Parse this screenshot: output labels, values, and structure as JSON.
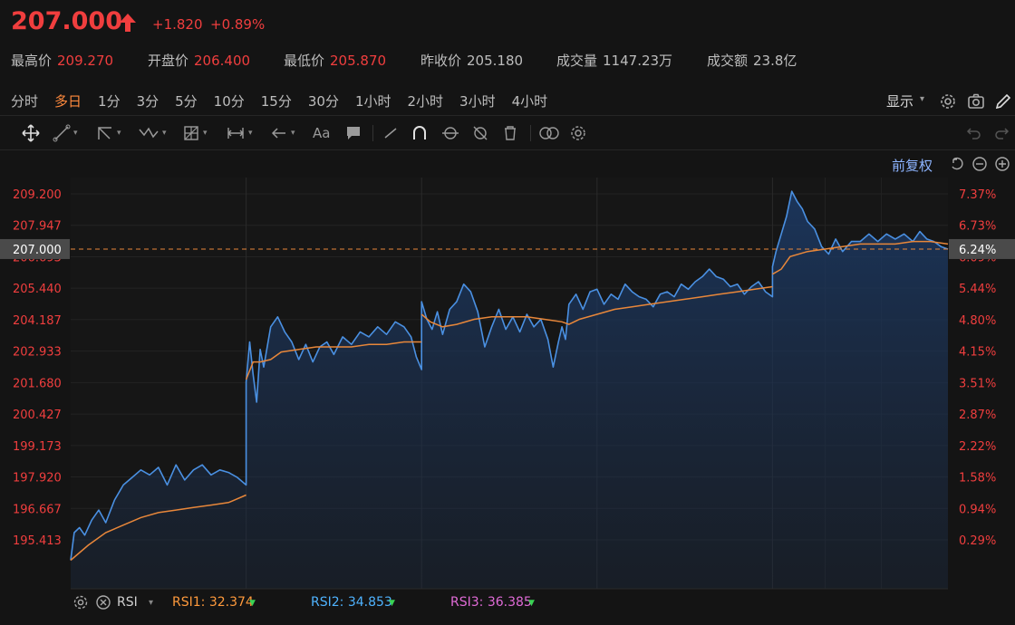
{
  "header": {
    "price": "207.000",
    "change": "+1.820",
    "change_pct": "+0.89%",
    "stats": [
      {
        "label": "最高价",
        "value": "209.270",
        "color": "#f03e3e"
      },
      {
        "label": "开盘价",
        "value": "206.400",
        "color": "#f03e3e"
      },
      {
        "label": "最低价",
        "value": "205.870",
        "color": "#f03e3e"
      },
      {
        "label": "昨收价",
        "value": "205.180",
        "color": "#bdbdbd"
      },
      {
        "label": "成交量",
        "value": "1147.23万",
        "color": "#bdbdbd"
      },
      {
        "label": "成交额",
        "value": "23.8亿",
        "color": "#bdbdbd"
      }
    ]
  },
  "tabs": [
    "分时",
    "多日",
    "1分",
    "3分",
    "5分",
    "10分",
    "15分",
    "30分",
    "1小时",
    "2小时",
    "3小时",
    "4小时"
  ],
  "active_tab": "多日",
  "toolbar": {
    "display_label": "显示",
    "font_tool_label": "Aa"
  },
  "chart_controls": {
    "adjust_label": "前复权"
  },
  "chart_data": {
    "type": "line",
    "y_ticks": [
      "209.200",
      "207.947",
      "206.693",
      "205.440",
      "204.187",
      "202.933",
      "201.680",
      "200.427",
      "199.173",
      "197.920",
      "196.667",
      "195.413"
    ],
    "y_tick_values": [
      209.2,
      207.947,
      206.693,
      205.44,
      204.187,
      202.933,
      201.68,
      200.427,
      199.173,
      197.92,
      196.667,
      195.413
    ],
    "pct_ticks": [
      "7.37%",
      "6.73%",
      "6.09%",
      "5.44%",
      "4.80%",
      "4.15%",
      "3.51%",
      "2.87%",
      "2.22%",
      "1.58%",
      "0.94%",
      "0.29%"
    ],
    "current_price_label": "207.000",
    "current_price_value": 207.0,
    "current_pct_label": "6.24%",
    "ylim": [
      194.2,
      210.4
    ],
    "days": 5,
    "price_series": {
      "name": "",
      "color": "#4a90e2",
      "points": [
        [
          0,
          194.6
        ],
        [
          0.02,
          195.7
        ],
        [
          0.05,
          195.9
        ],
        [
          0.08,
          195.6
        ],
        [
          0.12,
          196.2
        ],
        [
          0.16,
          196.6
        ],
        [
          0.2,
          196.1
        ],
        [
          0.25,
          197.0
        ],
        [
          0.3,
          197.6
        ],
        [
          0.35,
          197.9
        ],
        [
          0.4,
          198.2
        ],
        [
          0.45,
          198.0
        ],
        [
          0.5,
          198.3
        ],
        [
          0.55,
          197.6
        ],
        [
          0.6,
          198.4
        ],
        [
          0.65,
          197.8
        ],
        [
          0.7,
          198.2
        ],
        [
          0.75,
          198.4
        ],
        [
          0.8,
          198.0
        ],
        [
          0.85,
          198.2
        ],
        [
          0.9,
          198.1
        ],
        [
          0.95,
          197.9
        ],
        [
          1.0,
          197.6
        ],
        [
          1.0,
          201.7
        ],
        [
          1.02,
          203.3
        ],
        [
          1.04,
          202.0
        ],
        [
          1.06,
          200.9
        ],
        [
          1.08,
          203.0
        ],
        [
          1.1,
          202.3
        ],
        [
          1.14,
          203.9
        ],
        [
          1.18,
          204.3
        ],
        [
          1.22,
          203.7
        ],
        [
          1.26,
          203.3
        ],
        [
          1.3,
          202.6
        ],
        [
          1.34,
          203.2
        ],
        [
          1.38,
          202.5
        ],
        [
          1.42,
          203.1
        ],
        [
          1.46,
          203.3
        ],
        [
          1.5,
          202.8
        ],
        [
          1.55,
          203.5
        ],
        [
          1.6,
          203.2
        ],
        [
          1.65,
          203.7
        ],
        [
          1.7,
          203.5
        ],
        [
          1.75,
          203.9
        ],
        [
          1.8,
          203.6
        ],
        [
          1.85,
          204.1
        ],
        [
          1.9,
          203.9
        ],
        [
          1.94,
          203.5
        ],
        [
          1.97,
          202.7
        ],
        [
          2.0,
          202.2
        ],
        [
          2.0,
          204.9
        ],
        [
          2.03,
          204.2
        ],
        [
          2.06,
          203.8
        ],
        [
          2.09,
          204.5
        ],
        [
          2.12,
          203.6
        ],
        [
          2.16,
          204.6
        ],
        [
          2.2,
          204.9
        ],
        [
          2.24,
          205.6
        ],
        [
          2.28,
          205.3
        ],
        [
          2.32,
          204.5
        ],
        [
          2.36,
          203.1
        ],
        [
          2.4,
          203.9
        ],
        [
          2.44,
          204.6
        ],
        [
          2.48,
          203.8
        ],
        [
          2.52,
          204.3
        ],
        [
          2.56,
          203.7
        ],
        [
          2.6,
          204.4
        ],
        [
          2.64,
          203.9
        ],
        [
          2.68,
          204.2
        ],
        [
          2.72,
          203.4
        ],
        [
          2.75,
          202.3
        ],
        [
          2.78,
          203.3
        ],
        [
          2.8,
          203.9
        ],
        [
          2.82,
          203.4
        ],
        [
          2.84,
          204.8
        ],
        [
          2.88,
          205.2
        ],
        [
          2.92,
          204.6
        ],
        [
          2.96,
          205.3
        ],
        [
          3.0,
          205.4
        ],
        [
          3.04,
          204.8
        ],
        [
          3.08,
          205.2
        ],
        [
          3.12,
          205.0
        ],
        [
          3.16,
          205.6
        ],
        [
          3.2,
          205.3
        ],
        [
          3.24,
          205.1
        ],
        [
          3.28,
          205.0
        ],
        [
          3.32,
          204.7
        ],
        [
          3.36,
          205.2
        ],
        [
          3.4,
          205.3
        ],
        [
          3.44,
          205.1
        ],
        [
          3.48,
          205.6
        ],
        [
          3.52,
          205.4
        ],
        [
          3.56,
          205.7
        ],
        [
          3.6,
          205.9
        ],
        [
          3.64,
          206.2
        ],
        [
          3.68,
          205.9
        ],
        [
          3.72,
          205.8
        ],
        [
          3.76,
          205.5
        ],
        [
          3.8,
          205.6
        ],
        [
          3.84,
          205.2
        ],
        [
          3.88,
          205.5
        ],
        [
          3.92,
          205.7
        ],
        [
          3.96,
          205.3
        ],
        [
          4.0,
          205.1
        ],
        [
          4.0,
          206.3
        ],
        [
          4.02,
          206.9
        ],
        [
          4.05,
          207.6
        ],
        [
          4.08,
          208.3
        ],
        [
          4.11,
          209.3
        ],
        [
          4.14,
          208.9
        ],
        [
          4.17,
          208.6
        ],
        [
          4.2,
          208.1
        ],
        [
          4.24,
          207.8
        ],
        [
          4.28,
          207.1
        ],
        [
          4.32,
          206.8
        ],
        [
          4.36,
          207.4
        ],
        [
          4.4,
          206.9
        ],
        [
          4.45,
          207.3
        ],
        [
          4.5,
          207.3
        ],
        [
          4.55,
          207.6
        ],
        [
          4.6,
          207.3
        ],
        [
          4.65,
          207.6
        ],
        [
          4.7,
          207.4
        ],
        [
          4.75,
          207.6
        ],
        [
          4.8,
          207.3
        ],
        [
          4.84,
          207.7
        ],
        [
          4.88,
          207.4
        ],
        [
          4.92,
          207.3
        ],
        [
          4.96,
          207.1
        ],
        [
          5.0,
          207.0
        ]
      ]
    },
    "avg_series": {
      "name": "",
      "color": "#e8873a",
      "points": [
        [
          0,
          194.6
        ],
        [
          0.1,
          195.2
        ],
        [
          0.2,
          195.7
        ],
        [
          0.3,
          196.0
        ],
        [
          0.4,
          196.3
        ],
        [
          0.5,
          196.5
        ],
        [
          0.6,
          196.6
        ],
        [
          0.7,
          196.7
        ],
        [
          0.8,
          196.8
        ],
        [
          0.9,
          196.9
        ],
        [
          1.0,
          197.2
        ],
        [
          1.0,
          201.8
        ],
        [
          1.04,
          202.5
        ],
        [
          1.08,
          202.5
        ],
        [
          1.14,
          202.6
        ],
        [
          1.2,
          202.9
        ],
        [
          1.3,
          203.0
        ],
        [
          1.4,
          203.1
        ],
        [
          1.5,
          203.1
        ],
        [
          1.6,
          203.1
        ],
        [
          1.7,
          203.2
        ],
        [
          1.8,
          203.2
        ],
        [
          1.9,
          203.3
        ],
        [
          2.0,
          203.3
        ],
        [
          2.0,
          204.4
        ],
        [
          2.05,
          204.1
        ],
        [
          2.12,
          203.9
        ],
        [
          2.2,
          204.0
        ],
        [
          2.3,
          204.2
        ],
        [
          2.4,
          204.3
        ],
        [
          2.5,
          204.3
        ],
        [
          2.6,
          204.3
        ],
        [
          2.7,
          204.2
        ],
        [
          2.8,
          204.1
        ],
        [
          2.84,
          204.0
        ],
        [
          2.9,
          204.2
        ],
        [
          3.0,
          204.4
        ],
        [
          3.1,
          204.6
        ],
        [
          3.2,
          204.7
        ],
        [
          3.3,
          204.8
        ],
        [
          3.4,
          204.9
        ],
        [
          3.5,
          205.0
        ],
        [
          3.6,
          205.1
        ],
        [
          3.7,
          205.2
        ],
        [
          3.8,
          205.3
        ],
        [
          3.9,
          205.4
        ],
        [
          4.0,
          205.5
        ],
        [
          4.0,
          206.0
        ],
        [
          4.05,
          206.2
        ],
        [
          4.1,
          206.7
        ],
        [
          4.2,
          206.9
        ],
        [
          4.3,
          207.0
        ],
        [
          4.4,
          207.1
        ],
        [
          4.5,
          207.2
        ],
        [
          4.6,
          207.2
        ],
        [
          4.7,
          207.2
        ],
        [
          4.8,
          207.3
        ],
        [
          4.9,
          207.3
        ],
        [
          5.0,
          207.2
        ]
      ]
    },
    "grid": true
  },
  "rsi": {
    "label": "RSI",
    "rsi1": {
      "label": "RSI1: 32.374",
      "color": "#ff9a3c"
    },
    "rsi2": {
      "label": "RSI2: 34.853",
      "color": "#4fb3ff"
    },
    "rsi3": {
      "label": "RSI3: 36.385",
      "color": "#e06bd7"
    },
    "down_color": "#39d353"
  }
}
